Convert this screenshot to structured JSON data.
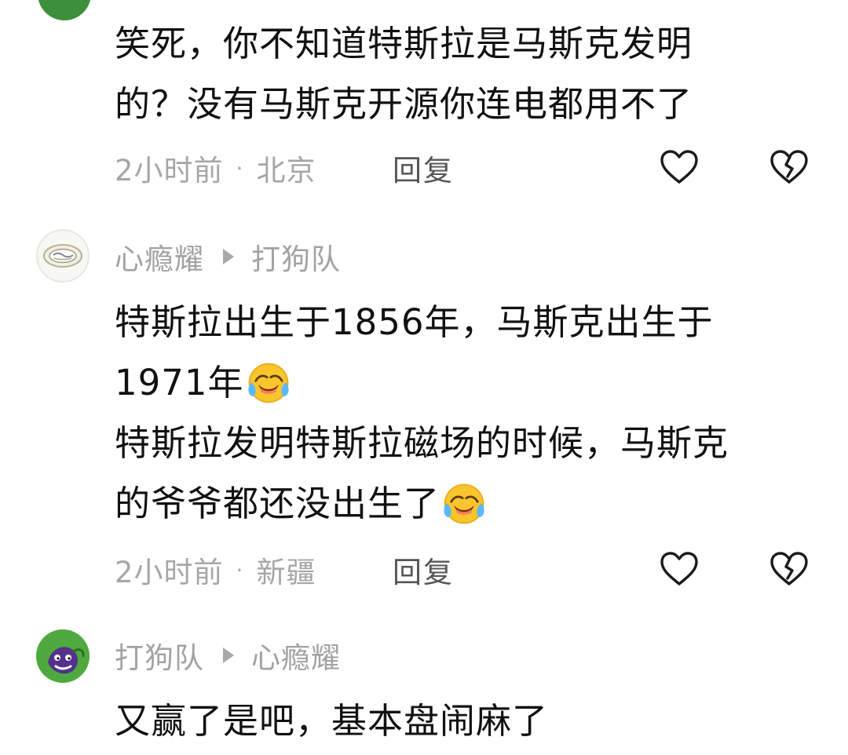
{
  "comments": [
    {
      "content": {
        "lines": [
          "笑死，你不知道特斯拉是马斯克发明",
          "的？没有马斯克开源你连电都用不了"
        ]
      },
      "meta": {
        "time": "2小时前",
        "separator": "·",
        "location": "北京"
      },
      "reply_label": "回复",
      "like_icon": "heart-outline-icon",
      "dislike_icon": "broken-heart-icon"
    },
    {
      "author": "心瘾耀",
      "reply_to": "打狗队",
      "content": {
        "lines": [
          "特斯拉出生于1856年，马斯克出生于",
          "1971年",
          "特斯拉发明特斯拉磁场的时候，马斯克",
          "的爷爷都还没出生了"
        ]
      },
      "meta": {
        "time": "2小时前",
        "separator": "·",
        "location": "新疆"
      },
      "reply_label": "回复",
      "emoji": "laughing-crying-emoji",
      "like_icon": "heart-outline-icon",
      "dislike_icon": "broken-heart-icon"
    },
    {
      "author": "打狗队",
      "reply_to": "心瘾耀",
      "content": {
        "lines": [
          "又赢了是吧，基本盘闹麻了"
        ]
      }
    }
  ],
  "colors": {
    "text": "#111111",
    "muted": "#a6a6a6",
    "icon": "#1a1a1a",
    "emoji": "#f8c52d"
  }
}
